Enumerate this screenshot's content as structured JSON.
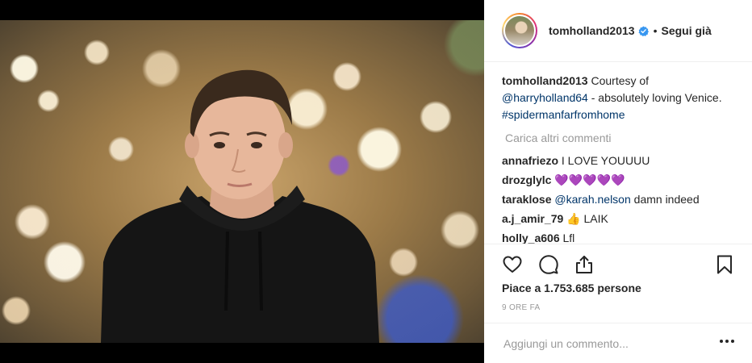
{
  "post": {
    "username": "tomholland2013",
    "separator": "•",
    "follow_label": "Segui già",
    "caption": {
      "username": "tomholland2013",
      "text_1": "Courtesy of",
      "mention": "@harryholland64",
      "text_2": "- absolutely loving Venice.",
      "hashtag": "#spidermanfarfromhome"
    },
    "load_more_label": "Carica altri commenti",
    "comments": [
      {
        "username": "annafriezo",
        "text": "I LOVE YOUUUU"
      },
      {
        "username": "drozglylc",
        "text": "💜💜💜💜💜"
      },
      {
        "username": "taraklose",
        "mention": "@karah.nelson",
        "text": "damn indeed"
      },
      {
        "username": "a.j_amir_79",
        "text": "👍 LAIK"
      },
      {
        "username": "holly_a606",
        "text": "Lfl"
      }
    ],
    "likes_text": "Piace a 1.753.685 persone",
    "time_text": "9 ORE FA",
    "add_comment_placeholder": "Aggiungi un commento..."
  },
  "icons": {
    "like": "heart-icon",
    "comment": "comment-icon",
    "share": "share-icon",
    "save": "bookmark-icon",
    "verified": "verified-badge-icon",
    "more": "more-options-icon"
  },
  "colors": {
    "link": "#003569",
    "muted": "#999999",
    "verified": "#3897f0",
    "text": "#262626"
  }
}
